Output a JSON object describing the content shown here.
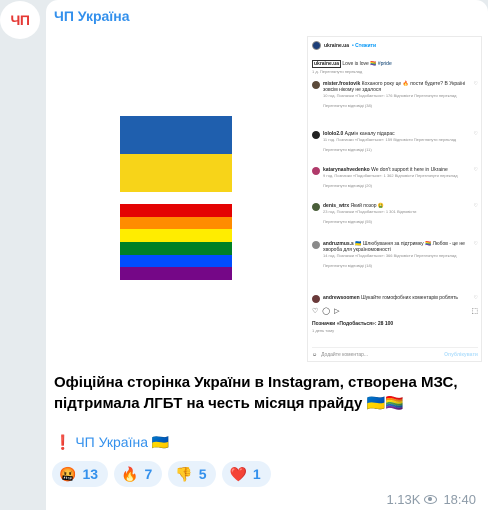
{
  "channel": {
    "avatar_text": "ЧП",
    "name": "ЧП Україна"
  },
  "colors": {
    "accent": "#3390ec",
    "ua_blue": "#1f5fae",
    "ua_yellow": "#f7d419",
    "rainbow": [
      "#e40303",
      "#ff8c00",
      "#ffed00",
      "#008026",
      "#004dff",
      "#750787"
    ]
  },
  "instagram": {
    "username": "ukraine.ua",
    "follow": "• Стежити",
    "caption": {
      "user": "ukraine.ua",
      "text": "Love is love 🏳️‍🌈",
      "tag": "#pride",
      "meta": "1 д. Переглянути переклад"
    },
    "comments": [
      {
        "user": "mister.frostovik",
        "text": "Коханого року це 🔥 пости будете? В Україні зовсім нікому не здалося",
        "meta": "10 год. Позначки «Подобається»: 176 Відповісти Переглянути переклад",
        "replies": "Переглянути відповіді (38)",
        "avatar": "#5b4a3a"
      },
      {
        "user": "lololo2.0",
        "text": "Адмін каналу підарас",
        "meta": "11 год. Позначки «Подобається»: 159 Відповісти Переглянути переклад",
        "replies": "Переглянути відповіді (11)",
        "avatar": "#222222"
      },
      {
        "user": "katarynashvedenko",
        "text": "We don't support it here in Ukraine",
        "meta": "9 год. Позначки «Подобається»: 1 362 Відповісти Переглянути переклад",
        "replies": "Переглянути відповіді (20)",
        "avatar": "#b03a6a"
      },
      {
        "user": "denis_wtrx",
        "text": "Який позор 🤮",
        "meta": "23 год. Позначки «Подобається»: 1 301 Відповісти",
        "replies": "Переглянути відповіді (55)",
        "avatar": "#4a5e3a"
      },
      {
        "user": "andruzmus.s",
        "text": "🇺🇦 Шлюбування за підтримку 🏳️‍🌈 Любов - це не хвороба для україномовності",
        "meta": "14 год. Позначки «Подобається»: 366 Відповісти Переглянути переклад",
        "replies": "Переглянути відповіді (18)",
        "avatar": "#8a8a8a"
      },
      {
        "user": "andrewsoomen",
        "text": "Шукайте гомофобних коментарів роблять",
        "meta": "",
        "replies": "",
        "avatar": "#6a3a3a"
      }
    ],
    "actions": [
      "♡",
      "◯",
      "▷",
      "⬚"
    ],
    "likes": "Позначки «Подобається»: 28 100",
    "date": "1 день тому",
    "add_comment": "Додайте коментар...",
    "post": "Опублікувати",
    "emoji": "☺"
  },
  "message": {
    "text": "Офіційна сторінка України в Instagram, створена МЗС, підтримала ЛГБТ на честь місяця прайду 🇺🇦🏳️‍🌈",
    "link_mark": "❗",
    "link_text": "ЧП Україна 🇺🇦"
  },
  "reactions": [
    {
      "emoji": "🤬",
      "count": "13"
    },
    {
      "emoji": "🔥",
      "count": "7"
    },
    {
      "emoji": "👎",
      "count": "5"
    },
    {
      "emoji": "❤️",
      "count": "1"
    }
  ],
  "footer": {
    "views": "1.13K",
    "time": "18:40",
    "eye_icon": "eye-icon"
  }
}
